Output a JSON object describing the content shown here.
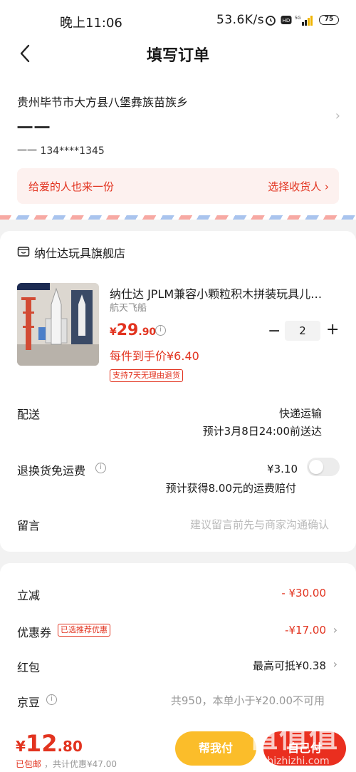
{
  "status_bar": {
    "time": "晚上11:06",
    "network_speed": "53.6K/s",
    "battery": "75"
  },
  "header": {
    "title": "填写订单"
  },
  "address": {
    "region": "贵州毕节市大方县八堡彝族苗族乡",
    "name": "一一",
    "contact": "一一  134****1345",
    "gift_left": "给爱的人也来一份",
    "gift_right": "选择收货人 ›"
  },
  "store": {
    "name": "纳仕达玩具旗舰店",
    "product": {
      "title": "纳仕达 JPLM兼容小颗粒积木拼装玩具儿…",
      "variant": "航天飞船",
      "price_currency": "¥",
      "price_int": "29",
      "price_dec": ".90",
      "per_item_price": "每件到手价¥6.40",
      "return_tag": "支持7天无理由退货",
      "quantity": "2",
      "minus": "−",
      "plus": "+"
    },
    "shipping_label": "配送",
    "shipping_method": "快递运输",
    "shipping_eta": "预计3月8日24:00前送达",
    "return_fee_label": "退换货免运费",
    "return_fee_price": "¥3.10",
    "return_fee_note": "预计获得8.00元的运费赔付",
    "message_label": "留言",
    "message_placeholder": "建议留言前先与商家沟通确认"
  },
  "discounts": {
    "instant_label": "立减",
    "instant_value": "- ¥30.00",
    "coupon_label": "优惠券",
    "coupon_tag": "已选推荐优惠",
    "coupon_value": "-¥17.00",
    "redpacket_label": "红包",
    "redpacket_value": "最高可抵¥0.38",
    "jingdou_label": "京豆",
    "jingdou_value": "共950，本单小于¥20.00不可用"
  },
  "bottom": {
    "currency": "¥",
    "total_int": "12",
    "total_dec": ".80",
    "shipping_note": "已包邮",
    "saving_note": "，共计优惠¥47.00",
    "help_pay": "帮我付",
    "pay": "自己付"
  },
  "watermark": {
    "main": "值值值",
    "sub": "zhizhizhi.com"
  },
  "colors": {
    "accent": "#e2331f",
    "help_button": "#fbbd2a",
    "pay_button": "#ea2f1f"
  }
}
